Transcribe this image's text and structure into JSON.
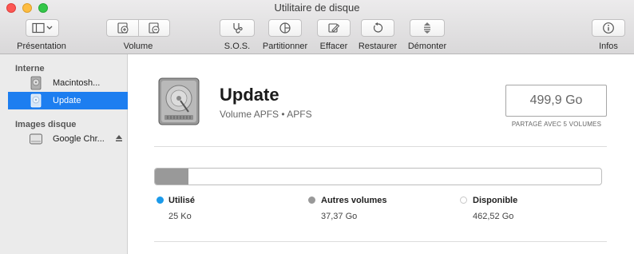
{
  "window": {
    "title": "Utilitaire de disque"
  },
  "toolbar": {
    "presentation": "Présentation",
    "volume": "Volume",
    "sos": "S.O.S.",
    "partition": "Partitionner",
    "erase": "Effacer",
    "restore": "Restaurer",
    "unmount": "Démonter",
    "info": "Infos"
  },
  "sidebar": {
    "internal_header": "Interne",
    "images_header": "Images disque",
    "items": [
      {
        "label": "Macintosh...",
        "icon": "internal-disk-icon"
      },
      {
        "label": "Update",
        "icon": "volume-disk-icon",
        "selected": true
      },
      {
        "label": "Google Chr...",
        "icon": "disk-image-icon"
      }
    ]
  },
  "volume": {
    "name": "Update",
    "subtitle": "Volume APFS • APFS",
    "capacity": "499,9 Go",
    "shared_note": "PARTAGÉ AVEC 5 VOLUMES"
  },
  "usage": {
    "used_fraction": 5e-08,
    "other_fraction": 0.0748,
    "legend": [
      {
        "label": "Utilisé",
        "value": "25 Ko",
        "color": "#1b9aea"
      },
      {
        "label": "Autres volumes",
        "value": "37,37 Go",
        "color": "#999999"
      },
      {
        "label": "Disponible",
        "value": "462,52 Go",
        "color": "#ffffff"
      }
    ]
  },
  "colors": {
    "accent": "#1d7ef0"
  }
}
